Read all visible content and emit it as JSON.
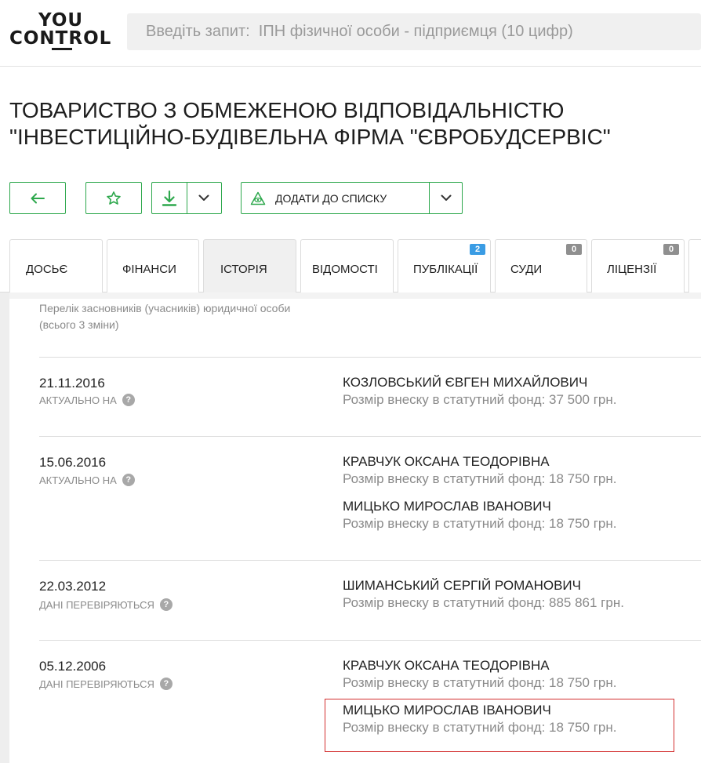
{
  "header": {
    "logo_top": "YOU",
    "logo_bottom": "CONTROL",
    "search_placeholder": "Введіть запит:  ІПН фізичної особи - підприємця (10 цифр)"
  },
  "company": {
    "title_line1": "ТОВАРИСТВО З ОБМЕЖЕНОЮ ВІДПОВІДАЛЬНІСТЮ",
    "title_line2": "\"ІНВЕСТИЦІЙНО-БУДІВЕЛЬНА ФІРМА \"ЄВРОБУДСЕРВІС\""
  },
  "actions": {
    "add_to_list": "ДОДАТИ ДО СПИСКУ"
  },
  "tabs": [
    {
      "label": "ДОСЬЄ",
      "active": false
    },
    {
      "label": "ФІНАНСИ",
      "active": false
    },
    {
      "label": "ІСТОРІЯ",
      "active": true
    },
    {
      "label": "ВІДОМОСТІ",
      "active": false
    },
    {
      "label": "ПУБЛІКАЦІЇ",
      "active": false,
      "badge": "2"
    },
    {
      "label": "СУДИ",
      "active": false,
      "badge": "0"
    },
    {
      "label": "ЛІЦЕНЗІЇ",
      "active": false,
      "badge": "0"
    }
  ],
  "founders": {
    "caption_line1": "Перелік засновників (учасників) юридичної особи",
    "caption_line2": "(всього 3 зміни)",
    "entries": [
      {
        "date": "21.11.2016",
        "status": "АКТУАЛЬНО НА",
        "persons": [
          {
            "name": "КОЗЛОВСЬКИЙ ЄВГЕН МИХАЙЛОВИЧ",
            "share": "Розмір внеску в статутний фонд: 37 500 грн."
          }
        ]
      },
      {
        "date": "15.06.2016",
        "status": "АКТУАЛЬНО НА",
        "persons": [
          {
            "name": "КРАВЧУК ОКСАНА ТЕОДОРІВНА",
            "share": "Розмір внеску в статутний фонд: 18 750 грн."
          },
          {
            "name": "МИЦЬКО МИРОСЛАВ ІВАНОВИЧ",
            "share": "Розмір внеску в статутний фонд: 18 750 грн."
          }
        ]
      },
      {
        "date": "22.03.2012",
        "status": "ДАНІ ПЕРЕВІРЯЮТЬСЯ",
        "persons": [
          {
            "name": "ШИМАНСЬКИЙ СЕРГІЙ РОМАНОВИЧ",
            "share": "Розмір внеску в статутний фонд: 885 861 грн."
          }
        ]
      },
      {
        "date": "05.12.2006",
        "status": "ДАНІ ПЕРЕВІРЯЮТЬСЯ",
        "persons": [
          {
            "name": "КРАВЧУК ОКСАНА ТЕОДОРІВНА",
            "share": "Розмір внеску в статутний фонд: 18 750 грн."
          },
          {
            "name": "МИЦЬКО МИРОСЛАВ ІВАНОВИЧ",
            "share": "Розмір внеску в статутний фонд: 18 750 грн."
          }
        ]
      }
    ]
  },
  "colors": {
    "accent_green": "#2ea84d",
    "highlight_red": "#d32f2f",
    "badge_blue": "#3a9ce4",
    "badge_grey": "#8f8f8f"
  }
}
